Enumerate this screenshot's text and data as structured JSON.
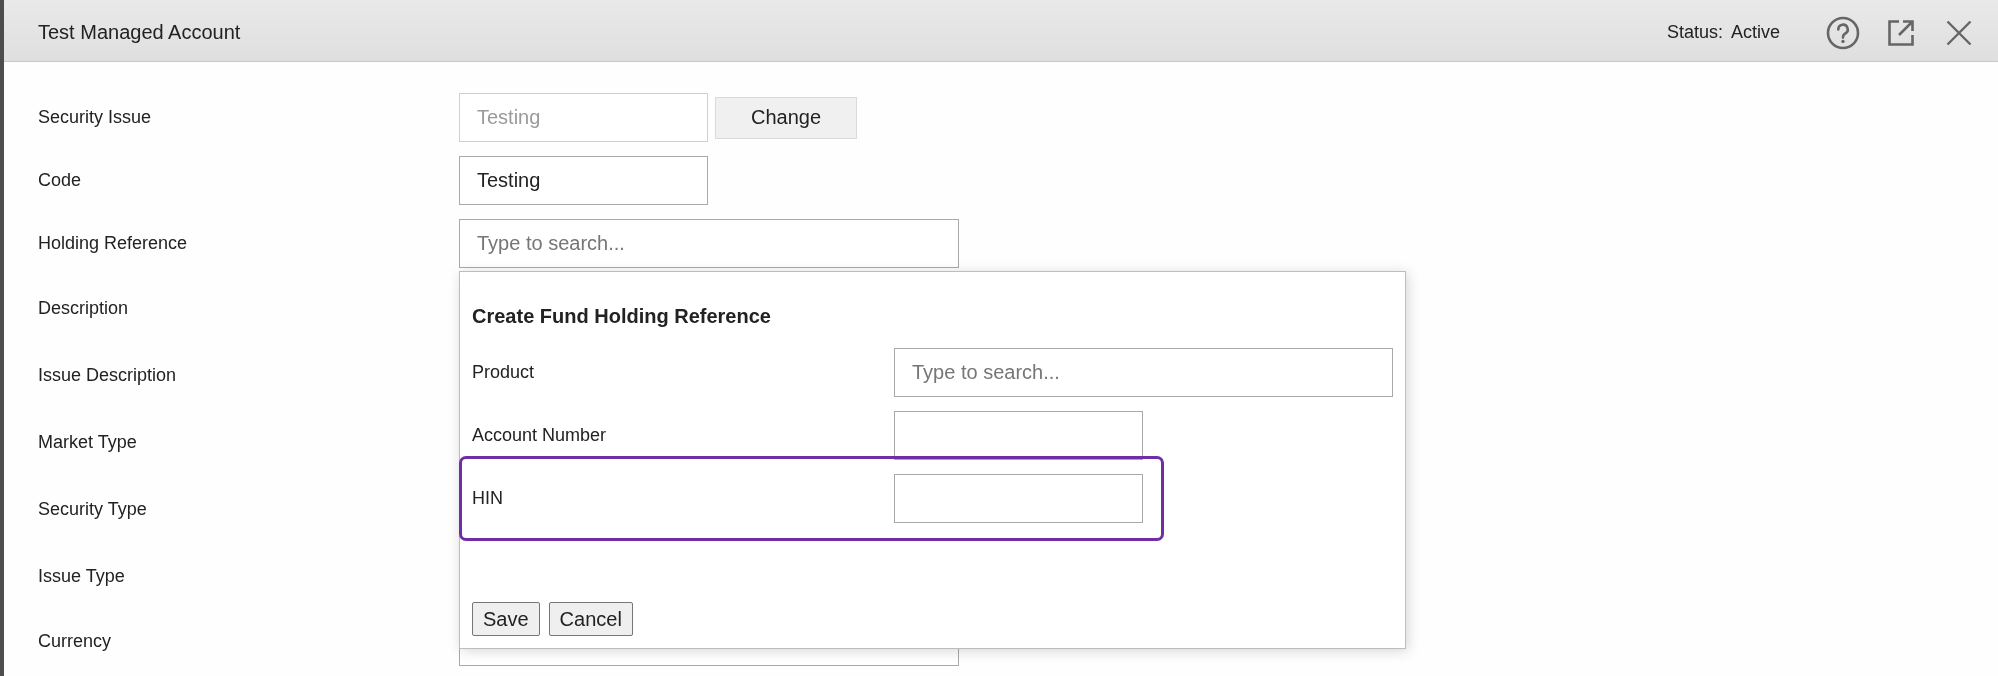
{
  "window": {
    "title": "Test Managed Account",
    "status_label": "Status:",
    "status_value": "Active"
  },
  "form": {
    "fields": [
      {
        "label": "Security Issue",
        "kind": "text",
        "value": "Testing",
        "disabled": true,
        "button": "Change"
      },
      {
        "label": "Code",
        "kind": "text",
        "value": "Testing",
        "disabled": false
      },
      {
        "label": "Holding Reference",
        "kind": "search",
        "placeholder": "Type to search..."
      },
      {
        "label": "Description",
        "kind": "covered"
      },
      {
        "label": "Issue Description",
        "kind": "covered"
      },
      {
        "label": "Market Type",
        "kind": "covered"
      },
      {
        "label": "Security Type",
        "kind": "covered"
      },
      {
        "label": "Issue Type",
        "kind": "covered"
      },
      {
        "label": "Currency",
        "kind": "select"
      }
    ]
  },
  "popup": {
    "title": "Create Fund Holding Reference",
    "fields": [
      {
        "label": "Product",
        "kind": "search",
        "placeholder": "Type to search...",
        "highlighted": false
      },
      {
        "label": "Account Number",
        "kind": "text",
        "highlighted": false
      },
      {
        "label": "HIN",
        "kind": "text",
        "highlighted": true
      }
    ],
    "buttons": [
      "Save",
      "Cancel"
    ]
  }
}
